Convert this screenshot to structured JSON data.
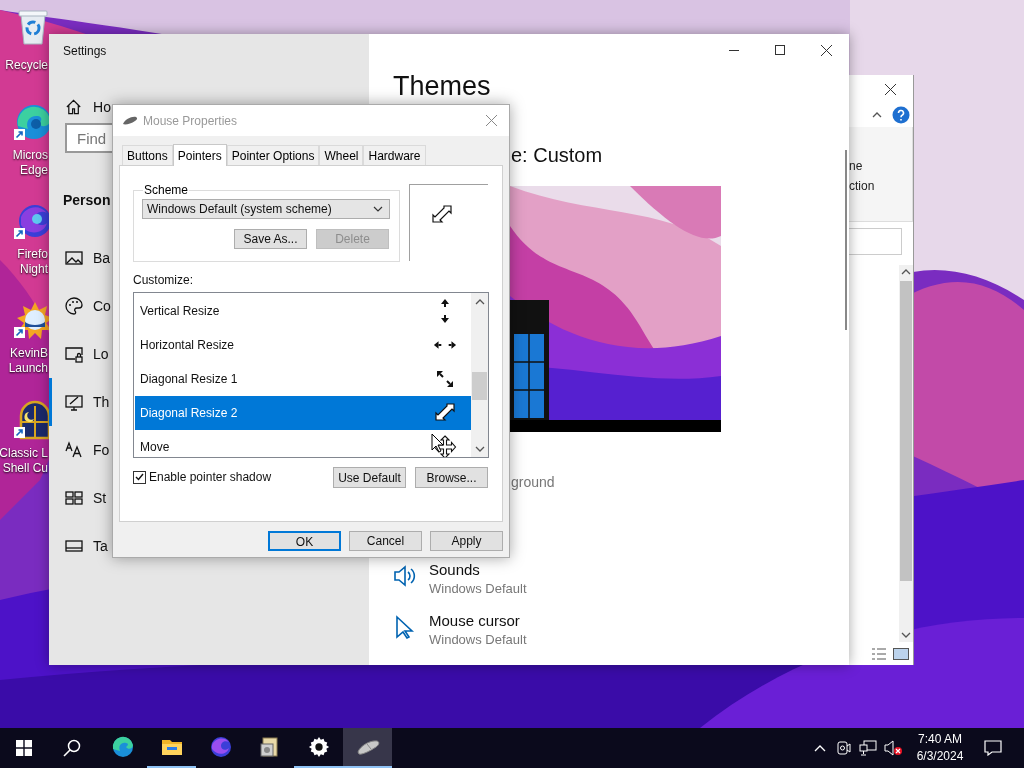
{
  "desktop_icons": [
    {
      "lines": [
        "Recycle"
      ]
    },
    {
      "lines": [
        "Micros",
        "Edge"
      ]
    },
    {
      "lines": [
        "Firefo",
        "Night"
      ]
    },
    {
      "lines": [
        "KevinB",
        "Launch"
      ]
    },
    {
      "lines": [
        "Classic L",
        "Shell Cu"
      ]
    }
  ],
  "settings": {
    "title": "Settings",
    "home": "Ho",
    "search_placeholder": "Find",
    "section": "Person",
    "nav": [
      {
        "label": "Ba",
        "selected": false
      },
      {
        "label": "Co",
        "selected": false
      },
      {
        "label": "Lo",
        "selected": false
      },
      {
        "label": "Th",
        "selected": true
      },
      {
        "label": "Fo",
        "selected": false
      },
      {
        "label": "St",
        "selected": false
      },
      {
        "label": "Ta",
        "selected": false
      }
    ],
    "heading": "Themes",
    "current_theme": "e: Custom",
    "background_label": "ground",
    "items": [
      {
        "title": "Sounds",
        "value": "Windows Default"
      },
      {
        "title": "Mouse cursor",
        "value": "Windows Default"
      }
    ]
  },
  "back_window": {
    "text_1": "ne",
    "text_2": "ction"
  },
  "dialog": {
    "title": "Mouse Properties",
    "tabs": [
      {
        "label": "Buttons",
        "selected": false
      },
      {
        "label": "Pointers",
        "selected": true
      },
      {
        "label": "Pointer Options",
        "selected": false
      },
      {
        "label": "Wheel",
        "selected": false
      },
      {
        "label": "Hardware",
        "selected": false
      }
    ],
    "scheme_label": "Scheme",
    "scheme_value": "Windows Default (system scheme)",
    "scheme_buttons": [
      {
        "label": "Save As...",
        "disabled": false
      },
      {
        "label": "Delete",
        "disabled": true
      }
    ],
    "customize_label": "Customize:",
    "cursors": [
      {
        "name": "Vertical Resize",
        "selected": false
      },
      {
        "name": "Horizontal Resize",
        "selected": false
      },
      {
        "name": "Diagonal Resize 1",
        "selected": false
      },
      {
        "name": "Diagonal Resize 2",
        "selected": true
      },
      {
        "name": "Move",
        "selected": false
      }
    ],
    "shadow": {
      "label": "Enable pointer shadow",
      "checked": true
    },
    "list_buttons": [
      "Use Default",
      "Browse..."
    ],
    "buttons": [
      {
        "label": "OK",
        "default": true
      },
      {
        "label": "Cancel",
        "default": false
      },
      {
        "label": "Apply",
        "default": false
      }
    ]
  },
  "taskbar": {
    "apps": [
      {
        "kind": "edge",
        "running": false,
        "selected": false
      },
      {
        "kind": "folder",
        "running": true,
        "selected": false
      },
      {
        "kind": "firefox",
        "running": false,
        "selected": false
      },
      {
        "kind": "archive",
        "running": false,
        "selected": false
      },
      {
        "kind": "settings",
        "running": true,
        "selected": false
      },
      {
        "kind": "mouse",
        "running": true,
        "selected": true
      }
    ],
    "time": "7:40 AM",
    "date": "6/3/2024"
  }
}
